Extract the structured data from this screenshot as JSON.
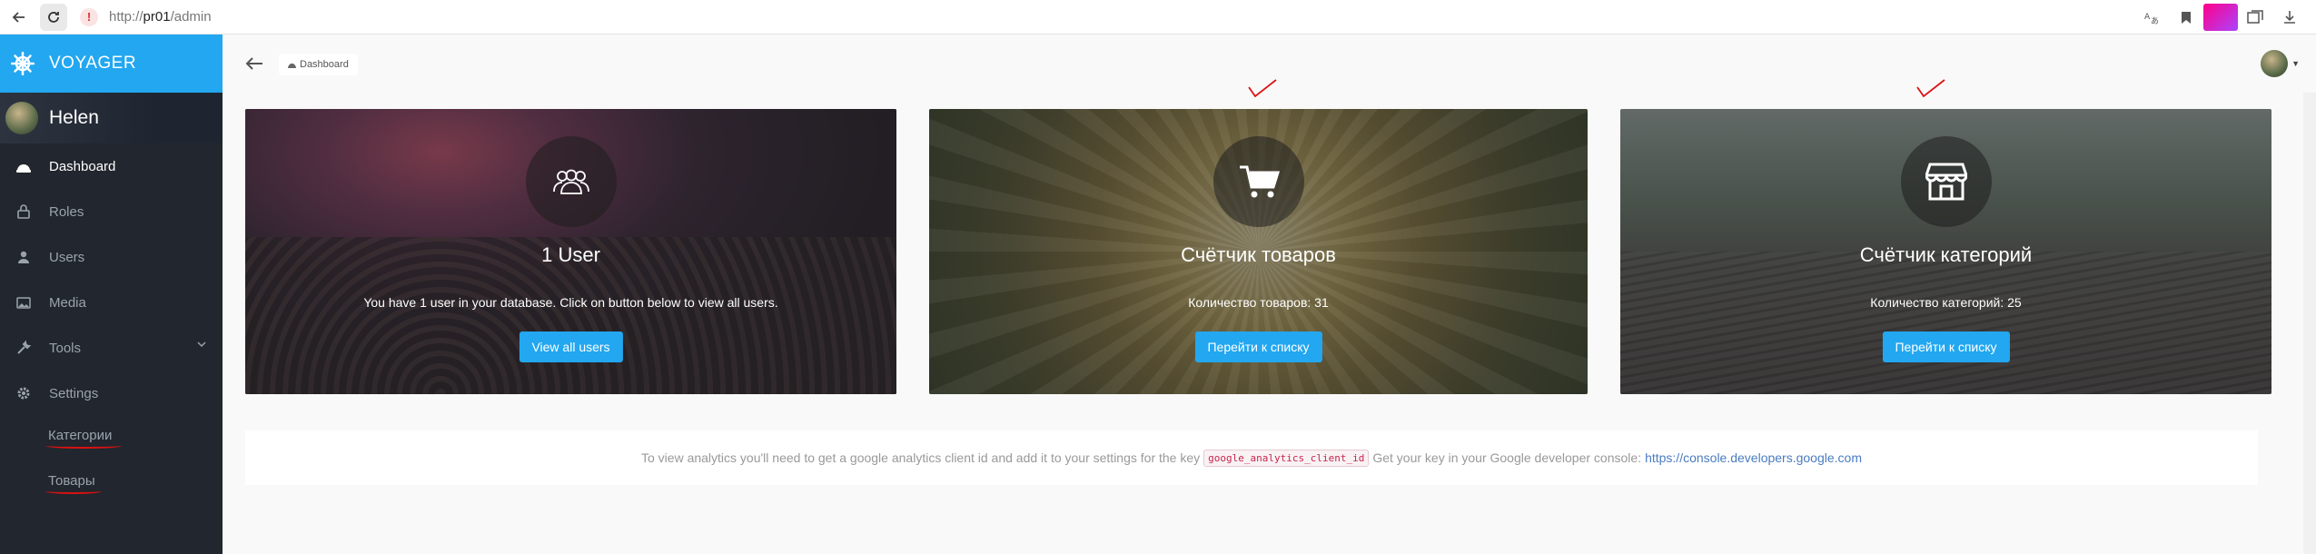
{
  "browser": {
    "url_scheme": "http://",
    "url_host": "pr01",
    "url_path": "/admin"
  },
  "sidebar": {
    "brand": "VOYAGER",
    "user_name": "Helen",
    "items": [
      {
        "label": "Dashboard",
        "icon": "dashboard-icon",
        "active": true
      },
      {
        "label": "Roles",
        "icon": "lock-icon"
      },
      {
        "label": "Users",
        "icon": "person-icon"
      },
      {
        "label": "Media",
        "icon": "image-icon"
      },
      {
        "label": "Tools",
        "icon": "wrench-icon"
      },
      {
        "label": "Settings",
        "icon": "gear-icon"
      }
    ],
    "custom_items": [
      {
        "label": "Категории"
      },
      {
        "label": "Товары"
      }
    ]
  },
  "topbar": {
    "breadcrumb": "Dashboard"
  },
  "cards": [
    {
      "title": "1 User",
      "description": "You have 1 user in your database. Click on button below to view all users.",
      "button": "View all users",
      "icon": "users-icon"
    },
    {
      "title": "Счётчик товаров",
      "description": "Количество товаров: 31",
      "button": "Перейти к списку",
      "icon": "cart-icon"
    },
    {
      "title": "Счётчик категорий",
      "description": "Количество категорий: 25",
      "button": "Перейти к списку",
      "icon": "store-icon"
    }
  ],
  "analytics": {
    "text_before": "To view analytics you'll need to get a google analytics client id and add it to your settings for the key",
    "key": "google_analytics_client_id",
    "text_after": "Get your key in your Google developer console:",
    "link": "https://console.developers.google.com"
  },
  "colors": {
    "accent": "#22a7f0",
    "sidebar_bg": "#22262e",
    "annotation_red": "#dd1111"
  }
}
